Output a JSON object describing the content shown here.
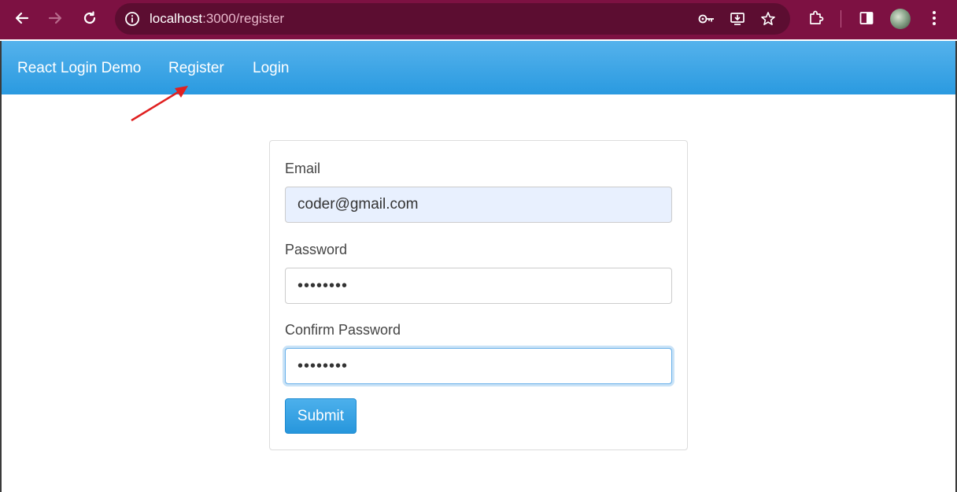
{
  "browser": {
    "url_host": "localhost",
    "url_path": ":3000/register",
    "icons": {
      "back": "arrow-left-icon",
      "forward": "arrow-right-icon",
      "reload": "reload-icon",
      "site_info": "info-icon",
      "password_key": "key-icon",
      "install_app": "install-icon",
      "bookmark": "star-icon",
      "extensions": "puzzle-icon",
      "side_panel": "side-panel-icon",
      "profile": "avatar",
      "menu": "kebab-menu-icon"
    }
  },
  "navbar": {
    "brand": "React Login Demo",
    "links": [
      "Register",
      "Login"
    ],
    "color": "#2a9ae0"
  },
  "annotation": {
    "arrow_color": "#e02020",
    "points_to": "Register"
  },
  "form": {
    "email_label": "Email",
    "email_value": "coder@gmail.com",
    "password_label": "Password",
    "password_value": "••••••••",
    "confirm_label": "Confirm Password",
    "confirm_value": "••••••••",
    "submit_label": "Submit"
  },
  "colors": {
    "chrome": "#7d1142",
    "omnibox": "#5c0d31",
    "primary": "#2a9ae0"
  }
}
